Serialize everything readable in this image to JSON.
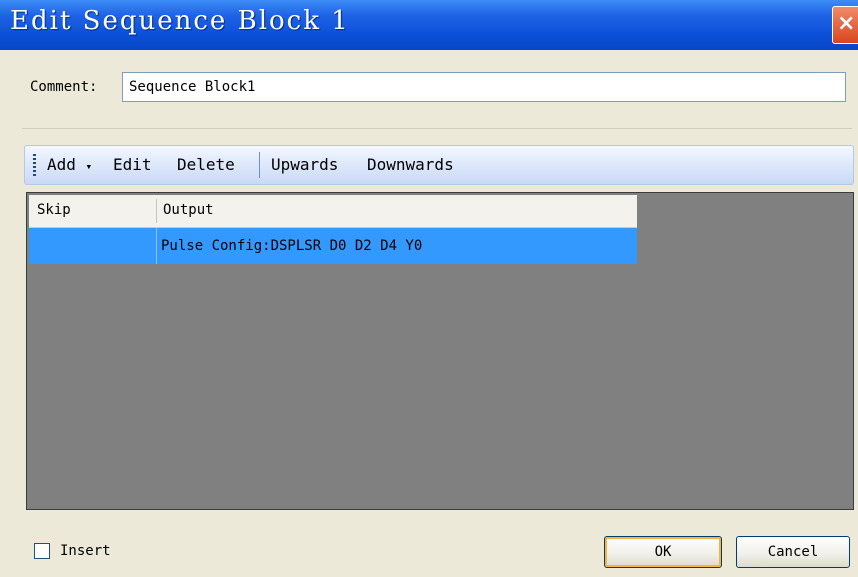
{
  "window": {
    "title": "Edit Sequence Block 1",
    "close_glyph": "×",
    "title_bar_color": "#0a4fd8"
  },
  "comment": {
    "label": "Comment:",
    "value": "Sequence Block1"
  },
  "toolbar": {
    "add_label": "Add",
    "add_dropdown_glyph": "▾",
    "edit_label": "Edit",
    "delete_label": "Delete",
    "upwards_label": "Upwards",
    "downwards_label": "Downwards"
  },
  "table": {
    "columns": [
      "Skip",
      "Output"
    ],
    "rows": [
      {
        "skip": "",
        "output": "Pulse Config:DSPLSR D0 D2 D4 Y0",
        "selected": true
      }
    ],
    "selection_color": "#3399ff"
  },
  "footer": {
    "insert_label": "Insert",
    "insert_checked": false,
    "ok_label": "OK",
    "cancel_label": "Cancel"
  }
}
